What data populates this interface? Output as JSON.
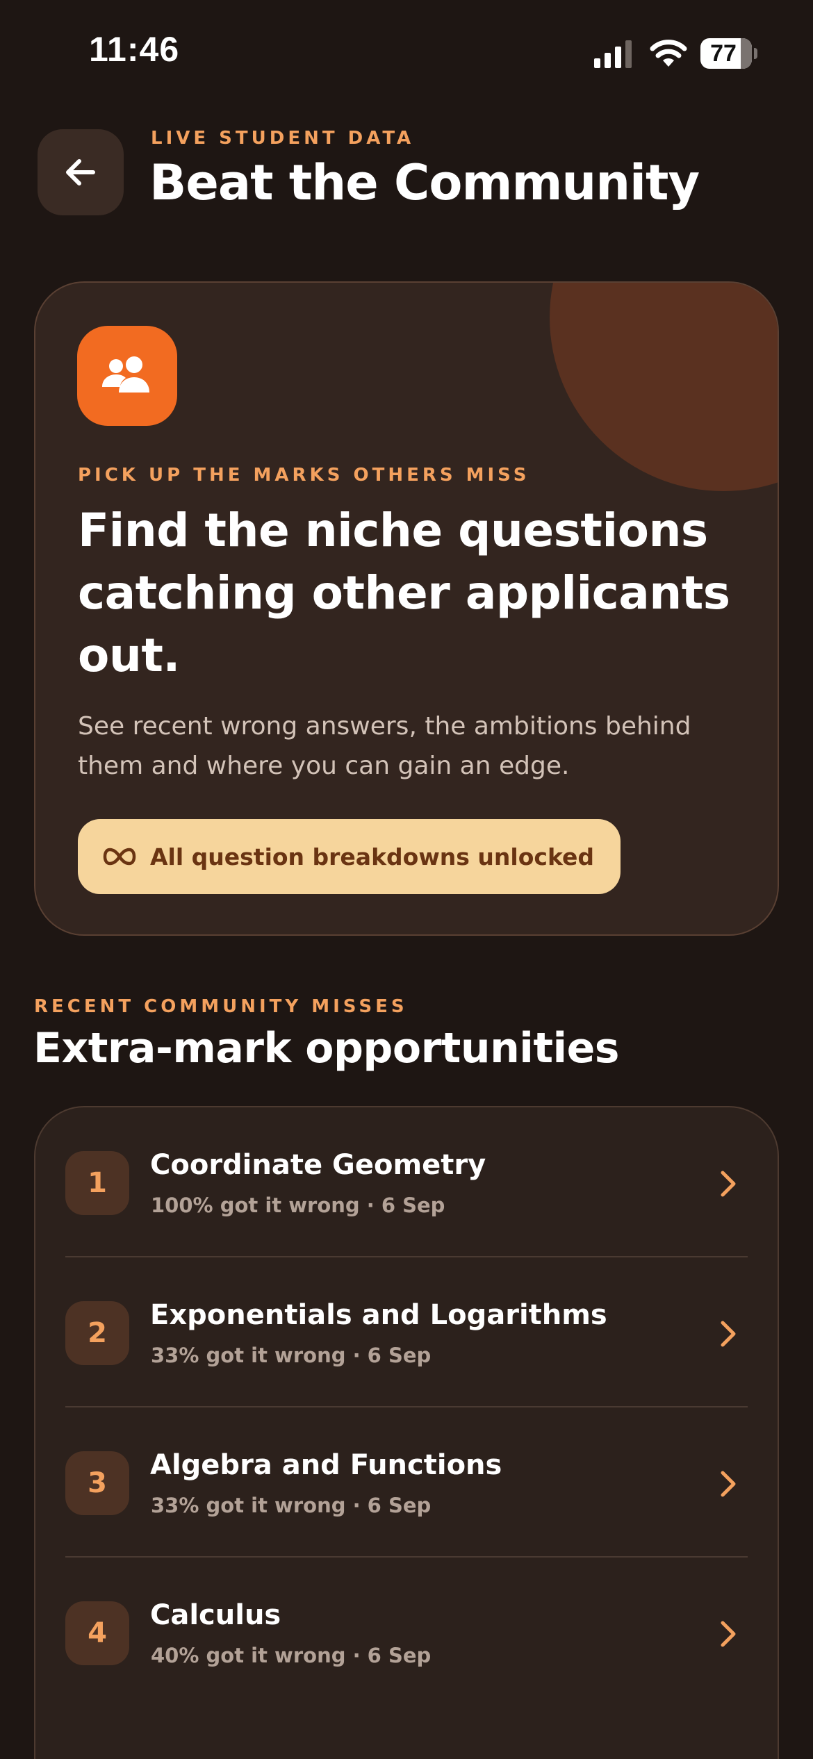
{
  "status_bar": {
    "time": "11:46",
    "battery": "77"
  },
  "header": {
    "eyebrow": "LIVE STUDENT DATA",
    "title": "Beat the Community",
    "back_icon": "arrow-left-icon"
  },
  "hero": {
    "icon": "users-icon",
    "eyebrow": "PICK UP THE MARKS OTHERS MISS",
    "title": "Find the niche questions catching other applicants out.",
    "description": "See recent wrong answers, the ambitions behind them and where you can gain an edge.",
    "unlock_label": "All question breakdowns unlocked",
    "unlock_icon": "infinity-icon"
  },
  "section": {
    "eyebrow": "RECENT COMMUNITY MISSES",
    "title": "Extra-mark opportunities"
  },
  "opportunities": [
    {
      "rank": "1",
      "topic": "Coordinate Geometry",
      "meta": "100% got it wrong · 6 Sep"
    },
    {
      "rank": "2",
      "topic": "Exponentials and Logarithms",
      "meta": "33% got it wrong · 6 Sep"
    },
    {
      "rank": "3",
      "topic": "Algebra and Functions",
      "meta": "33% got it wrong · 6 Sep"
    },
    {
      "rank": "4",
      "topic": "Calculus",
      "meta": "40% got it wrong · 6 Sep"
    }
  ],
  "colors": {
    "background": "#1e1613",
    "card": "#33251f",
    "accent": "#f4a15e",
    "brand_orange": "#f26b21",
    "pill": "#f6d59c"
  }
}
